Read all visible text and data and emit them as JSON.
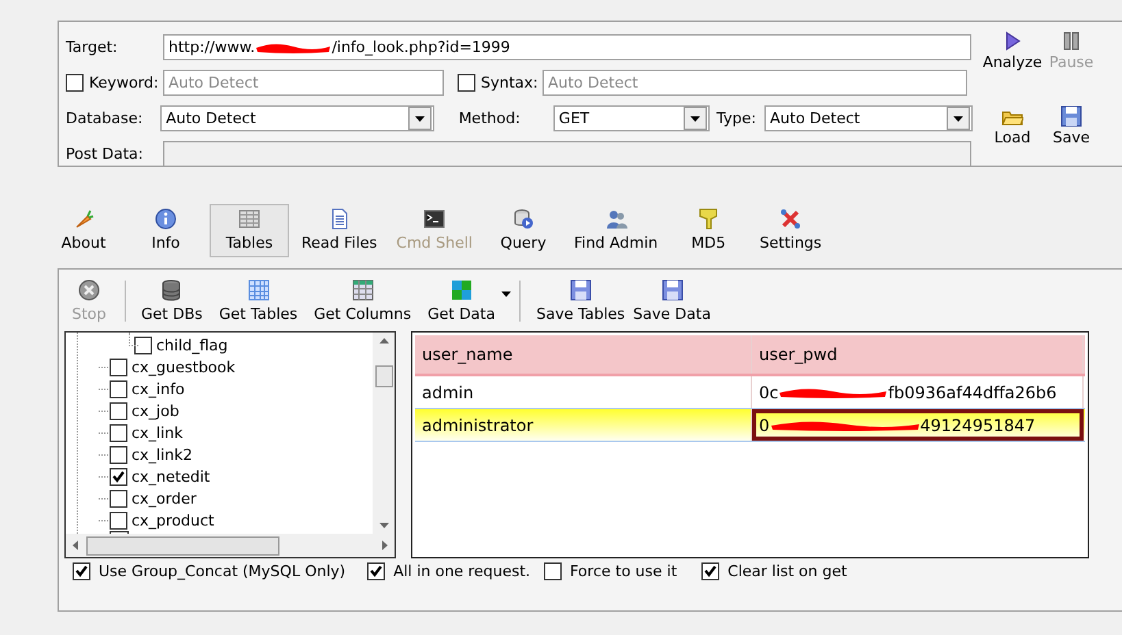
{
  "form": {
    "target_label": "Target:",
    "target_before": "http://www.",
    "target_after": "/info_look.php?id=1999",
    "keyword": {
      "label": "Keyword:",
      "checked": false,
      "placeholder": "Auto Detect"
    },
    "syntax": {
      "label": "Syntax:",
      "checked": false,
      "placeholder": "Auto Detect"
    },
    "database": {
      "label": "Database:",
      "value": "Auto Detect"
    },
    "method": {
      "label": "Method:",
      "value": "GET"
    },
    "type": {
      "label": "Type:",
      "value": "Auto Detect"
    },
    "post_label": "Post Data:",
    "actions": [
      {
        "label": "Analyze",
        "disabled": false
      },
      {
        "label": "Pause",
        "disabled": true
      },
      {
        "label": "Load",
        "disabled": false
      },
      {
        "label": "Save",
        "disabled": false
      }
    ]
  },
  "tabs": [
    {
      "label": "About",
      "selected": false,
      "disabled": false
    },
    {
      "label": "Info",
      "selected": false,
      "disabled": false
    },
    {
      "label": "Tables",
      "selected": true,
      "disabled": false
    },
    {
      "label": "Read Files",
      "selected": false,
      "disabled": false
    },
    {
      "label": "Cmd Shell",
      "selected": false,
      "disabled": true
    },
    {
      "label": "Query",
      "selected": false,
      "disabled": false
    },
    {
      "label": "Find Admin",
      "selected": false,
      "disabled": false
    },
    {
      "label": "MD5",
      "selected": false,
      "disabled": false
    },
    {
      "label": "Settings",
      "selected": false,
      "disabled": false
    }
  ],
  "toolbar": [
    {
      "label": "Stop",
      "disabled": true
    },
    {
      "label": "Get DBs",
      "disabled": false
    },
    {
      "label": "Get Tables",
      "disabled": false
    },
    {
      "label": "Get Columns",
      "disabled": false
    },
    {
      "label": "Get Data",
      "disabled": false
    },
    {
      "label": "Save Tables",
      "disabled": false
    },
    {
      "label": "Save Data",
      "disabled": false
    }
  ],
  "tree": [
    {
      "label": "child_flag",
      "kind": "column",
      "checked": false
    },
    {
      "label": "cx_guestbook",
      "kind": "table",
      "checked": false
    },
    {
      "label": "cx_info",
      "kind": "table",
      "checked": false
    },
    {
      "label": "cx_job",
      "kind": "table",
      "checked": false
    },
    {
      "label": "cx_link",
      "kind": "table",
      "checked": false
    },
    {
      "label": "cx_link2",
      "kind": "table",
      "checked": false
    },
    {
      "label": "cx_netedit",
      "kind": "table",
      "checked": true
    },
    {
      "label": "cx_order",
      "kind": "table",
      "checked": false
    },
    {
      "label": "cx_product",
      "kind": "table",
      "checked": false
    }
  ],
  "table": {
    "columns": [
      "user_name",
      "user_pwd"
    ],
    "rows": [
      {
        "selected": false,
        "user_name": "admin",
        "pwd_before": "0c",
        "pwd_after": "fb0936af44dffa26b6"
      },
      {
        "selected": true,
        "user_name": "administrator",
        "pwd_before": "0",
        "pwd_after": "49124951847"
      }
    ]
  },
  "options": [
    {
      "label": "Use Group_Concat (MySQL Only)",
      "checked": true
    },
    {
      "label": "All in one request.",
      "checked": true
    },
    {
      "label": "Force to use it",
      "checked": false
    },
    {
      "label": "Clear list on get",
      "checked": true
    }
  ]
}
